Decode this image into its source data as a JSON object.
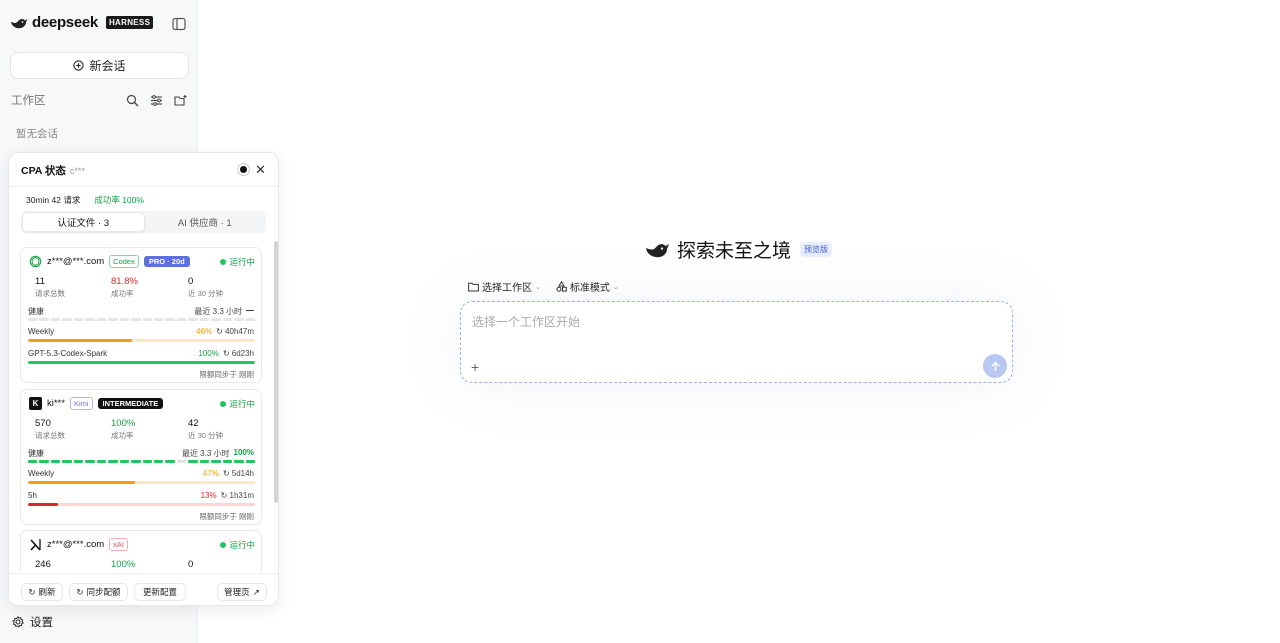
{
  "sidebar": {
    "logo_text": "deepseek",
    "badge": "HARNESS",
    "new_chat": "新会话",
    "workspace_label": "工作区",
    "empty_text": "暂无会话",
    "settings": "设置"
  },
  "cpa": {
    "title": "CPA 状态",
    "subtitle": "c***",
    "stats_requests": "30min 42 请求",
    "stats_success": "成功率 100%",
    "tabs": [
      "认证文件 · 3",
      "AI 供应商 · 1"
    ],
    "cards": [
      {
        "account": "z***@***.com",
        "provider": "Codex",
        "tier": "PRO · 20d",
        "status": "运行中",
        "total": "11",
        "total_label": "请求总数",
        "rate": "81.8%",
        "rate_label": "成功率",
        "recent": "0",
        "recent_label": "近 30 分钟",
        "health_label": "健康",
        "health_window": "最近 3.3 小时",
        "health_value": "—",
        "limits": [
          {
            "name": "Weekly",
            "pct": "46%",
            "reset": "↻ 40h47m",
            "fraction": 0.46,
            "color": "#f59e0b"
          },
          {
            "name": "GPT-5.3-Codex-Spark",
            "pct": "100%",
            "reset": "↻ 6d23h",
            "fraction": 1.0,
            "color": "#22c55e"
          }
        ],
        "sync": "限额同步于 刚刚"
      },
      {
        "account": "ki***",
        "provider": "Kimi",
        "tier": "INTERMEDIATE",
        "status": "运行中",
        "total": "570",
        "total_label": "请求总数",
        "rate": "100%",
        "rate_label": "成功率",
        "recent": "42",
        "recent_label": "近 30 分钟",
        "health_label": "健康",
        "health_window": "最近 3.3 小时",
        "health_value": "100%",
        "limits": [
          {
            "name": "Weekly",
            "pct": "47%",
            "reset": "↻ 5d14h",
            "fraction": 0.47,
            "color": "#f59e0b"
          },
          {
            "name": "5h",
            "pct": "13%",
            "reset": "↻ 1h31m",
            "fraction": 0.13,
            "color": "#dc2626"
          }
        ],
        "sync": "限额同步于 刚刚"
      },
      {
        "account": "z***@***.com",
        "provider": "xAI",
        "status": "运行中",
        "total": "246",
        "rate": "100%",
        "recent": "0"
      }
    ],
    "footer": {
      "refresh": "刷新",
      "sync_quota": "同步配额",
      "update_config": "更新配置",
      "manage": "管理页"
    }
  },
  "main": {
    "title": "探索未至之境",
    "preview_badge": "预览版",
    "workspace_select": "选择工作区",
    "mode_select": "标准模式",
    "input_placeholder": "选择一个工作区开始"
  },
  "colors": {
    "success": "#16a34a",
    "warning": "#f59e0b",
    "danger": "#dc2626",
    "accent": "#5b6fe0",
    "send_button": "#b8c8f0"
  }
}
